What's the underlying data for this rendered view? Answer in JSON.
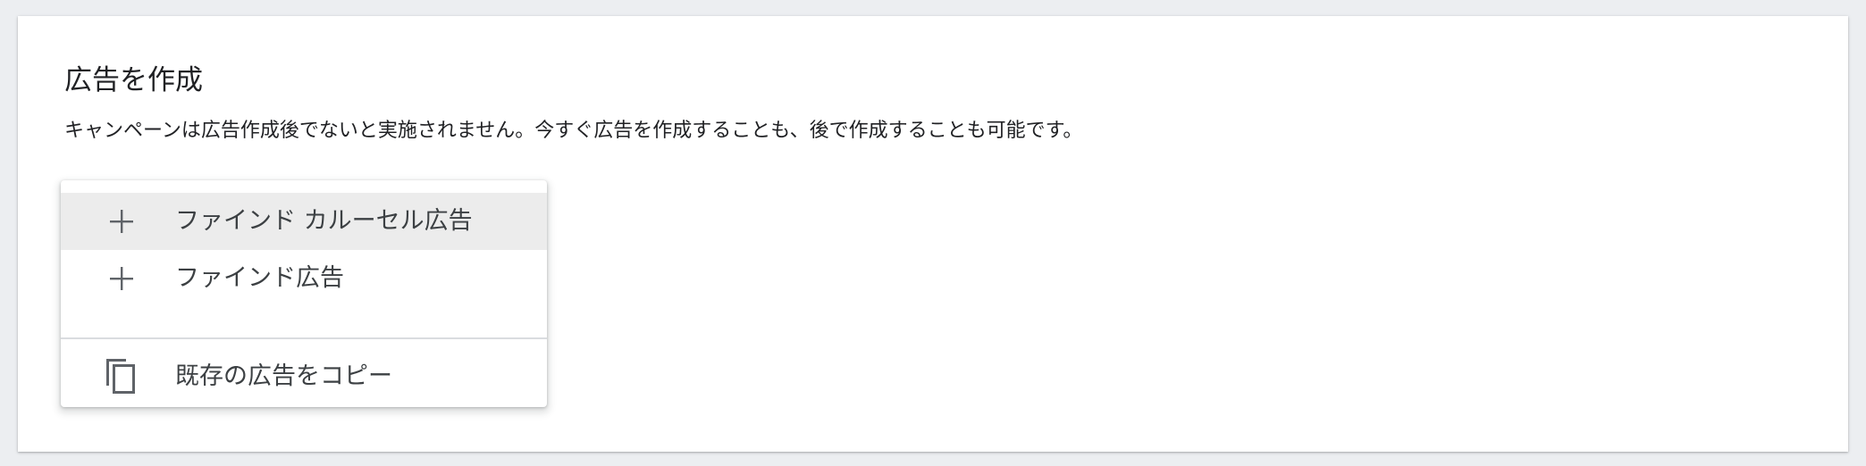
{
  "section": {
    "title": "広告を作成",
    "description": "キャンペーンは広告作成後でないと実施されません。今すぐ広告を作成することも、後で作成することも可能です。"
  },
  "menu": {
    "items": [
      {
        "label": "ファインド カルーセル広告",
        "icon": "plus-icon",
        "highlighted": true
      },
      {
        "label": "ファインド広告",
        "icon": "plus-icon",
        "highlighted": false
      },
      {
        "label": "既存の広告をコピー",
        "icon": "copy-icon",
        "highlighted": false
      }
    ]
  },
  "colors": {
    "card_background": "#ffffff",
    "page_background": "#eceef1",
    "hover_background": "#ececec",
    "icon_color": "#5f6368",
    "text_color": "#202124"
  }
}
